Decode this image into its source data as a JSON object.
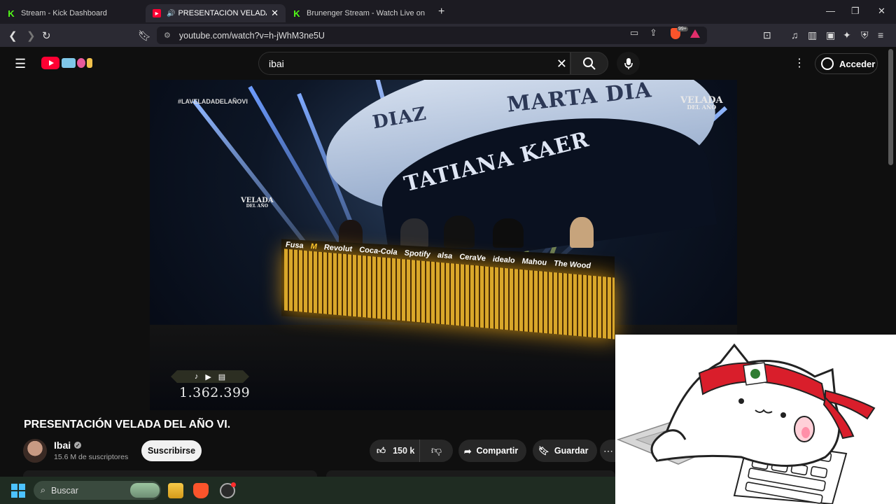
{
  "browser": {
    "tabs": [
      {
        "title": "Stream - Kick Dashboard",
        "favicon": "kick-icon",
        "active": false
      },
      {
        "title": "PRESENTACIÓN VELADA DEL AÑO VI.",
        "favicon": "youtube-icon",
        "active": true,
        "audio": true
      },
      {
        "title": "Brunenger Stream - Watch Live on Kick",
        "favicon": "kick-icon",
        "active": false
      }
    ],
    "url": "youtube.com/watch?v=h-jWhM3ne5U",
    "brave_badge": "99+",
    "window_controls": {
      "minimize": "—",
      "restore": "❐",
      "close": "✕"
    }
  },
  "youtube": {
    "search_value": "ibai",
    "sign_in_label": "Acceder",
    "video": {
      "title": "PRESENTACIÓN VELADA DEL AÑO VI.",
      "hashtag": "#LAVELADADELAÑOVI",
      "counter": "1.362.399",
      "screen_names": [
        "DIAZ",
        "MARTA DIA",
        "TATIANA KAER"
      ],
      "logo_top": "VELADA",
      "logo_bottom": "DEL AÑO",
      "sponsors": [
        "Fusa",
        "M",
        "Revolut",
        "Coca-Cola",
        "Spotify",
        "alsa",
        "CeraVe",
        "idealo",
        "Mahou",
        "The Wood"
      ]
    },
    "channel": {
      "name": "Ibai",
      "subscribers": "15.6 M de suscriptores",
      "subscribe_label": "Suscribirse"
    },
    "actions": {
      "likes": "150 k",
      "share_label": "Compartir",
      "save_label": "Guardar"
    }
  },
  "taskbar": {
    "search_placeholder": "Buscar"
  },
  "colors": {
    "youtube_red": "#ff0033",
    "kick_green": "#53fc18",
    "brave_orange": "#fb542b"
  }
}
